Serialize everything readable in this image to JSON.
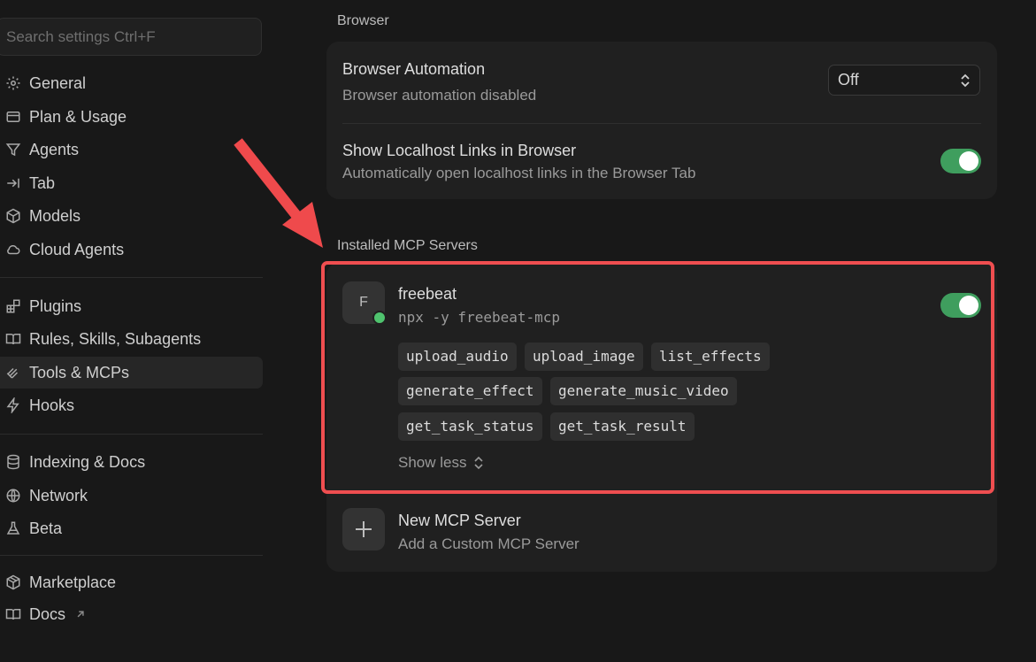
{
  "search": {
    "placeholder": "Search settings Ctrl+F"
  },
  "sidebar": {
    "items": [
      {
        "label": "General",
        "icon": "gear-icon"
      },
      {
        "label": "Plan & Usage",
        "icon": "credit-card-icon"
      },
      {
        "label": "Agents",
        "icon": "filter-icon"
      },
      {
        "label": "Tab",
        "icon": "arrow-to-right-icon"
      },
      {
        "label": "Models",
        "icon": "cube-icon"
      },
      {
        "label": "Cloud Agents",
        "icon": "cloud-icon"
      },
      {
        "label": "Plugins",
        "icon": "blocks-icon"
      },
      {
        "label": "Rules, Skills, Subagents",
        "icon": "book-open-icon"
      },
      {
        "label": "Tools & MCPs",
        "icon": "tools-icon"
      },
      {
        "label": "Hooks",
        "icon": "bolt-icon"
      },
      {
        "label": "Indexing & Docs",
        "icon": "database-icon"
      },
      {
        "label": "Network",
        "icon": "globe-icon"
      },
      {
        "label": "Beta",
        "icon": "flask-icon"
      },
      {
        "label": "Marketplace",
        "icon": "package-icon"
      },
      {
        "label": "Docs",
        "icon": "book-open-icon"
      }
    ],
    "active": "Tools & MCPs"
  },
  "browser": {
    "section_label": "Browser",
    "automation": {
      "title": "Browser Automation",
      "subtitle": "Browser automation disabled",
      "value": "Off"
    },
    "localhost": {
      "title": "Show Localhost Links in Browser",
      "subtitle": "Automatically open localhost links in the Browser Tab",
      "enabled": true
    }
  },
  "mcp": {
    "section_label": "Installed MCP Servers",
    "server": {
      "initial": "F",
      "name": "freebeat",
      "command": "npx -y freebeat-mcp",
      "enabled": true,
      "tools": [
        "upload_audio",
        "upload_image",
        "list_effects",
        "generate_effect",
        "generate_music_video",
        "get_task_status",
        "get_task_result"
      ],
      "show_less": "Show less"
    },
    "new_server": {
      "title": "New MCP Server",
      "subtitle": "Add a Custom MCP Server"
    }
  },
  "colors": {
    "accent_toggle": "#3f9e5e",
    "highlight": "#ef4e50",
    "status_online": "#4fc36e"
  }
}
